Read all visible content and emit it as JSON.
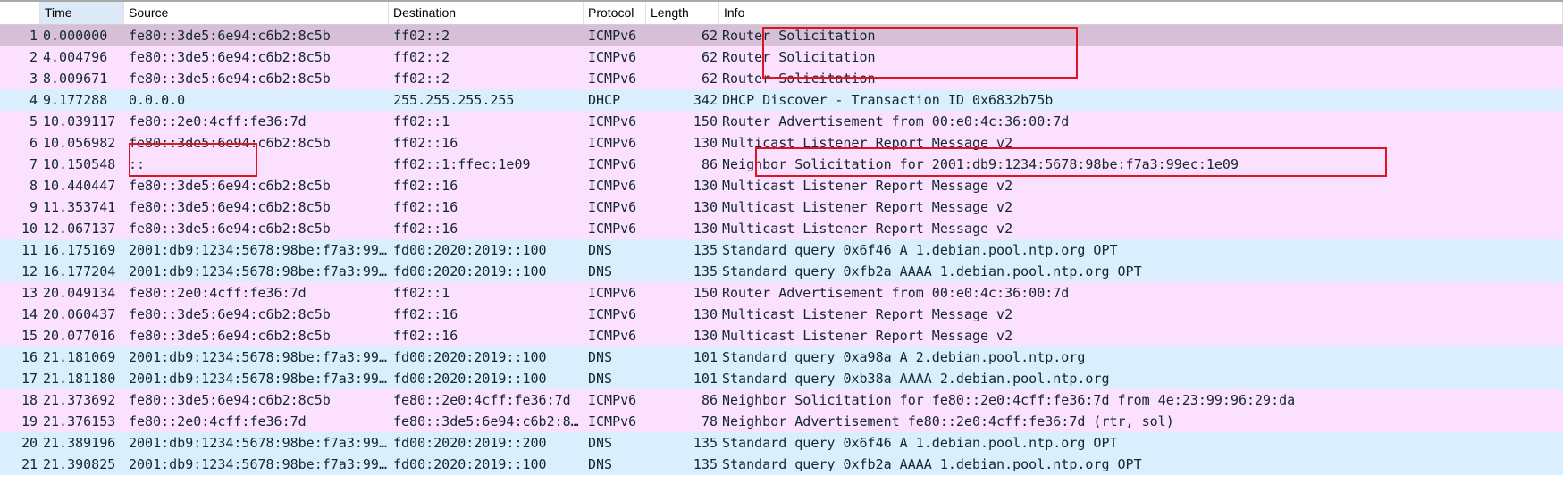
{
  "columns": [
    "",
    "Time",
    "Source",
    "Destination",
    "Protocol",
    "Length",
    "Info"
  ],
  "colors": {
    "selected": "#d7bfd8",
    "icmpv6": "#fce0ff",
    "udp": "#daeefe",
    "text": "#12272e",
    "highlight_box": "#e0141e"
  },
  "packets": [
    {
      "no": "1",
      "time": "0.000000",
      "source": "fe80::3de5:6e94:c6b2:8c5b",
      "destination": "ff02::2",
      "protocol": "ICMPv6",
      "length": "62",
      "info": "Router Solicitation",
      "selected": true
    },
    {
      "no": "2",
      "time": "4.004796",
      "source": "fe80::3de5:6e94:c6b2:8c5b",
      "destination": "ff02::2",
      "protocol": "ICMPv6",
      "length": "62",
      "info": "Router Solicitation"
    },
    {
      "no": "3",
      "time": "8.009671",
      "source": "fe80::3de5:6e94:c6b2:8c5b",
      "destination": "ff02::2",
      "protocol": "ICMPv6",
      "length": "62",
      "info": "Router Solicitation"
    },
    {
      "no": "4",
      "time": "9.177288",
      "source": "0.0.0.0",
      "destination": "255.255.255.255",
      "protocol": "DHCP",
      "length": "342",
      "info": "DHCP Discover - Transaction ID 0x6832b75b"
    },
    {
      "no": "5",
      "time": "10.039117",
      "source": "fe80::2e0:4cff:fe36:7d",
      "destination": "ff02::1",
      "protocol": "ICMPv6",
      "length": "150",
      "info": "Router Advertisement from 00:e0:4c:36:00:7d"
    },
    {
      "no": "6",
      "time": "10.056982",
      "source": "fe80::3de5:6e94:c6b2:8c5b",
      "destination": "ff02::16",
      "protocol": "ICMPv6",
      "length": "130",
      "info": "Multicast Listener Report Message v2"
    },
    {
      "no": "7",
      "time": "10.150548",
      "source": "::",
      "destination": "ff02::1:ffec:1e09",
      "protocol": "ICMPv6",
      "length": "86",
      "info": "Neighbor Solicitation for 2001:db9:1234:5678:98be:f7a3:99ec:1e09"
    },
    {
      "no": "8",
      "time": "10.440447",
      "source": "fe80::3de5:6e94:c6b2:8c5b",
      "destination": "ff02::16",
      "protocol": "ICMPv6",
      "length": "130",
      "info": "Multicast Listener Report Message v2"
    },
    {
      "no": "9",
      "time": "11.353741",
      "source": "fe80::3de5:6e94:c6b2:8c5b",
      "destination": "ff02::16",
      "protocol": "ICMPv6",
      "length": "130",
      "info": "Multicast Listener Report Message v2"
    },
    {
      "no": "10",
      "time": "12.067137",
      "source": "fe80::3de5:6e94:c6b2:8c5b",
      "destination": "ff02::16",
      "protocol": "ICMPv6",
      "length": "130",
      "info": "Multicast Listener Report Message v2"
    },
    {
      "no": "11",
      "time": "16.175169",
      "source": "2001:db9:1234:5678:98be:f7a3:99…",
      "destination": "fd00:2020:2019::100",
      "protocol": "DNS",
      "length": "135",
      "info": "Standard query 0x6f46 A 1.debian.pool.ntp.org OPT"
    },
    {
      "no": "12",
      "time": "16.177204",
      "source": "2001:db9:1234:5678:98be:f7a3:99…",
      "destination": "fd00:2020:2019::100",
      "protocol": "DNS",
      "length": "135",
      "info": "Standard query 0xfb2a AAAA 1.debian.pool.ntp.org OPT"
    },
    {
      "no": "13",
      "time": "20.049134",
      "source": "fe80::2e0:4cff:fe36:7d",
      "destination": "ff02::1",
      "protocol": "ICMPv6",
      "length": "150",
      "info": "Router Advertisement from 00:e0:4c:36:00:7d"
    },
    {
      "no": "14",
      "time": "20.060437",
      "source": "fe80::3de5:6e94:c6b2:8c5b",
      "destination": "ff02::16",
      "protocol": "ICMPv6",
      "length": "130",
      "info": "Multicast Listener Report Message v2"
    },
    {
      "no": "15",
      "time": "20.077016",
      "source": "fe80::3de5:6e94:c6b2:8c5b",
      "destination": "ff02::16",
      "protocol": "ICMPv6",
      "length": "130",
      "info": "Multicast Listener Report Message v2"
    },
    {
      "no": "16",
      "time": "21.181069",
      "source": "2001:db9:1234:5678:98be:f7a3:99…",
      "destination": "fd00:2020:2019::100",
      "protocol": "DNS",
      "length": "101",
      "info": "Standard query 0xa98a A 2.debian.pool.ntp.org"
    },
    {
      "no": "17",
      "time": "21.181180",
      "source": "2001:db9:1234:5678:98be:f7a3:99…",
      "destination": "fd00:2020:2019::100",
      "protocol": "DNS",
      "length": "101",
      "info": "Standard query 0xb38a AAAA 2.debian.pool.ntp.org"
    },
    {
      "no": "18",
      "time": "21.373692",
      "source": "fe80::3de5:6e94:c6b2:8c5b",
      "destination": "fe80::2e0:4cff:fe36:7d",
      "protocol": "ICMPv6",
      "length": "86",
      "info": "Neighbor Solicitation for fe80::2e0:4cff:fe36:7d from 4e:23:99:96:29:da"
    },
    {
      "no": "19",
      "time": "21.376153",
      "source": "fe80::2e0:4cff:fe36:7d",
      "destination": "fe80::3de5:6e94:c6b2:8…",
      "protocol": "ICMPv6",
      "length": "78",
      "info": "Neighbor Advertisement fe80::2e0:4cff:fe36:7d (rtr, sol)"
    },
    {
      "no": "20",
      "time": "21.389196",
      "source": "2001:db9:1234:5678:98be:f7a3:99…",
      "destination": "fd00:2020:2019::200",
      "protocol": "DNS",
      "length": "135",
      "info": "Standard query 0x6f46 A 1.debian.pool.ntp.org OPT"
    },
    {
      "no": "21",
      "time": "21.390825",
      "source": "2001:db9:1234:5678:98be:f7a3:99…",
      "destination": "fd00:2020:2019::100",
      "protocol": "DNS",
      "length": "135",
      "info": "Standard query 0xfb2a AAAA 1.debian.pool.ntp.org OPT"
    }
  ]
}
